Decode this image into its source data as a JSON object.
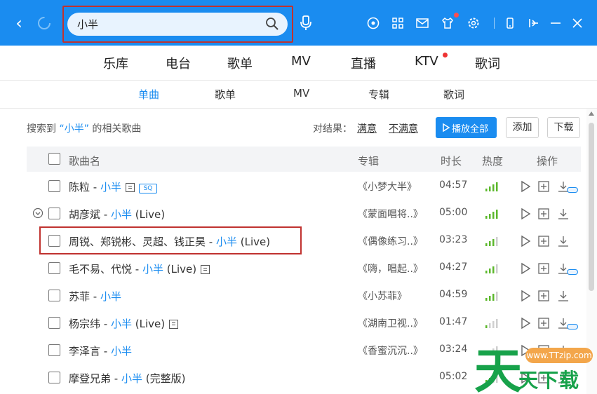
{
  "search": {
    "value": "小半"
  },
  "main_tabs": [
    {
      "label": "乐库"
    },
    {
      "label": "电台"
    },
    {
      "label": "歌单"
    },
    {
      "label": "MV"
    },
    {
      "label": "直播"
    },
    {
      "label": "KTV"
    },
    {
      "label": "歌词"
    }
  ],
  "sub_tabs": [
    {
      "label": "单曲",
      "active": true
    },
    {
      "label": "歌单"
    },
    {
      "label": "MV"
    },
    {
      "label": "专辑"
    },
    {
      "label": "歌词"
    }
  ],
  "results": {
    "prefix": "搜索到",
    "query": "“小半”",
    "suffix": "的相关歌曲",
    "feedback_label": "对结果：",
    "satisfied": "满意",
    "unsatisfied": "不满意",
    "play_all": "播放全部",
    "add": "添加",
    "download": "下载"
  },
  "table": {
    "headers": {
      "name": "歌曲名",
      "album": "专辑",
      "duration": "时长",
      "heat": "热度",
      "actions": "操作"
    },
    "rows": [
      {
        "artist": "陈粒",
        "sep": " - ",
        "song": "小半",
        "extra": "",
        "album": "《小梦大半》",
        "duration": "04:57",
        "heat_level": 4,
        "doc_badge": true,
        "sq_badge": "SQ"
      },
      {
        "artist": "胡彦斌",
        "sep": " - ",
        "song": "小半",
        "extra": " (Live)",
        "album": "《蒙面唱将..》",
        "duration": "05:00",
        "heat_level": 4
      },
      {
        "artist": "周锐、郑锐彬、灵超、钱正昊",
        "sep": " - ",
        "song": "小半",
        "extra": " (Live)",
        "album": "《偶像练习..》",
        "duration": "03:23",
        "heat_level": 3
      },
      {
        "artist": "毛不易、代悦",
        "sep": " - ",
        "song": "小半",
        "extra": " (Live)",
        "album": "《嗨，唱起..》",
        "duration": "04:27",
        "heat_level": 3,
        "doc_badge": true
      },
      {
        "artist": "苏菲",
        "sep": " - ",
        "song": "小半",
        "extra": "",
        "album": "《小苏菲》",
        "duration": "04:59",
        "heat_level": 3
      },
      {
        "artist": "杨宗纬",
        "sep": " - ",
        "song": "小半",
        "extra": " (Live)",
        "album": "《湖南卫视..》",
        "duration": "01:47",
        "heat_level": 1,
        "doc_badge": true
      },
      {
        "artist": "李泽言",
        "sep": " - ",
        "song": "小半",
        "extra": "",
        "album": "《香蜜沉沉..》",
        "duration": "03:24",
        "heat_level": 2
      },
      {
        "artist": "摩登兄弟",
        "sep": " - ",
        "song": "小半",
        "extra": " (完整版)",
        "album": "",
        "duration": "05:02",
        "heat_level": 2
      }
    ]
  },
  "watermark": {
    "url": "www.TTzip.com",
    "brand": "天下载"
  },
  "colors": {
    "accent": "#1a8cf0",
    "highlight": "#c0322f",
    "heat": "#5cb82c"
  }
}
